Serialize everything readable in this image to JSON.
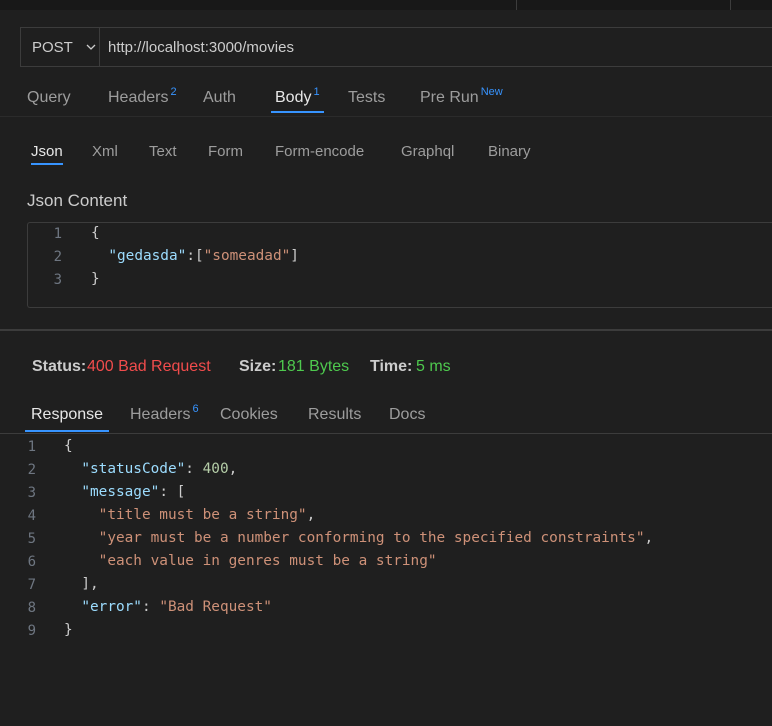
{
  "request": {
    "method": "POST",
    "url": "http://localhost:3000/movies"
  },
  "request_tabs": [
    {
      "label": "Query",
      "badge": ""
    },
    {
      "label": "Headers",
      "badge": "2"
    },
    {
      "label": "Auth",
      "badge": ""
    },
    {
      "label": "Body",
      "badge": "1"
    },
    {
      "label": "Tests",
      "badge": ""
    },
    {
      "label": "Pre Run",
      "badge": "New"
    }
  ],
  "active_request_tab": "Body",
  "body_tabs": [
    "Json",
    "Xml",
    "Text",
    "Form",
    "Form-encode",
    "Graphql",
    "Binary"
  ],
  "active_body_tab": "Json",
  "json_content_label": "Json Content",
  "request_body_lines": [
    "1",
    "2",
    "3"
  ],
  "request_body_text": {
    "open": "{",
    "key": "\"gedasda\"",
    "colon": ":[",
    "value": "\"someadad\"",
    "close_bracket": "]",
    "close": "}"
  },
  "status": {
    "status_label": "Status:",
    "status_value": "400 Bad Request",
    "size_label": "Size:",
    "size_value": "181 Bytes",
    "time_label": "Time:",
    "time_value": "5 ms"
  },
  "response_tabs": [
    {
      "label": "Response",
      "badge": ""
    },
    {
      "label": "Headers",
      "badge": "6"
    },
    {
      "label": "Cookies",
      "badge": ""
    },
    {
      "label": "Results",
      "badge": ""
    },
    {
      "label": "Docs",
      "badge": ""
    }
  ],
  "active_response_tab": "Response",
  "response_line_numbers": [
    "1",
    "2",
    "3",
    "4",
    "5",
    "6",
    "7",
    "8",
    "9"
  ],
  "response_body": {
    "open": "{",
    "status_key": "\"statusCode\"",
    "status_val": "400",
    "message_key": "\"message\"",
    "msg1": "\"title must be a string\"",
    "msg2": "\"year must be a number conforming to the specified constraints\"",
    "msg3": "\"each value in genres must be a string\"",
    "arr_close": "],",
    "error_key": "\"error\"",
    "error_val": "\"Bad Request\"",
    "close": "}"
  },
  "colors": {
    "accent": "#3794ff",
    "status_error": "#f14c4c",
    "status_ok": "#4ec94e",
    "json_key": "#9cdcfe",
    "json_string": "#ce9178",
    "json_number": "#b5cea8"
  }
}
